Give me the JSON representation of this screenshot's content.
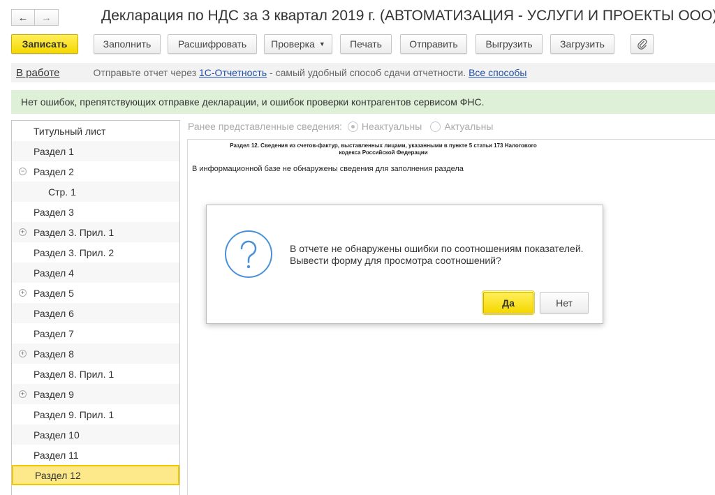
{
  "window": {
    "title": "Декларация по НДС за 3 квартал 2019 г. (АВТОМАТИЗАЦИЯ - УСЛУГИ И ПРОЕКТЫ ООО)",
    "back_glyph": "←",
    "forward_glyph": "→"
  },
  "toolbar": {
    "save": "Записать",
    "fill": "Заполнить",
    "decode": "Расшифровать",
    "check": "Проверка",
    "print": "Печать",
    "send": "Отправить",
    "export": "Выгрузить",
    "import": "Загрузить",
    "attach_icon": "paperclip-icon"
  },
  "status": {
    "state": "В работе",
    "text_before": "Отправьте отчет через ",
    "link_1c": "1С-Отчетность",
    "text_after": " - самый удобный способ сдачи отчетности. ",
    "link_all": "Все способы"
  },
  "info": {
    "message": "Нет ошибок, препятствующих отправке декларации, и ошибок проверки контрагентов сервисом ФНС."
  },
  "tree": {
    "items": [
      {
        "label": "Титульный лист"
      },
      {
        "label": "Раздел 1"
      },
      {
        "label": "Раздел 2"
      },
      {
        "label": "Стр. 1"
      },
      {
        "label": "Раздел 3"
      },
      {
        "label": "Раздел 3. Прил. 1"
      },
      {
        "label": "Раздел 3. Прил. 2"
      },
      {
        "label": "Раздел 4"
      },
      {
        "label": "Раздел 5"
      },
      {
        "label": "Раздел 6"
      },
      {
        "label": "Раздел 7"
      },
      {
        "label": "Раздел 8"
      },
      {
        "label": "Раздел 8. Прил. 1"
      },
      {
        "label": "Раздел 9"
      },
      {
        "label": "Раздел 9. Прил. 1"
      },
      {
        "label": "Раздел 10"
      },
      {
        "label": "Раздел 11"
      },
      {
        "label": "Раздел 12"
      }
    ],
    "selected": "Раздел 12"
  },
  "previous_data": {
    "label": "Ранее представленные сведения:",
    "option_irrelevant": "Неактуальны",
    "option_relevant": "Актуальны",
    "selected": "Неактуальны"
  },
  "report": {
    "heading_line1": "Раздел 12. Сведения из счетов-фактур, выставленных лицами, указанными в пункте 5 статьи 173 Налогового",
    "heading_line2": "кодекса Российской Федерации",
    "note": "В информационной базе не обнаружены сведения для заполнения раздела"
  },
  "dialog": {
    "line1": "В отчете не обнаружены ошибки по соотношениям показателей.",
    "line2": "Вывести форму для просмотра соотношений?",
    "yes": "Да",
    "no": "Нет",
    "icon": "question-icon"
  },
  "colors": {
    "accent_yellow": "#f5d800",
    "link_blue": "#1f4fa8",
    "success_bg": "#dff0d8",
    "selection_bg": "#fde98a",
    "icon_blue": "#4a90d9"
  }
}
